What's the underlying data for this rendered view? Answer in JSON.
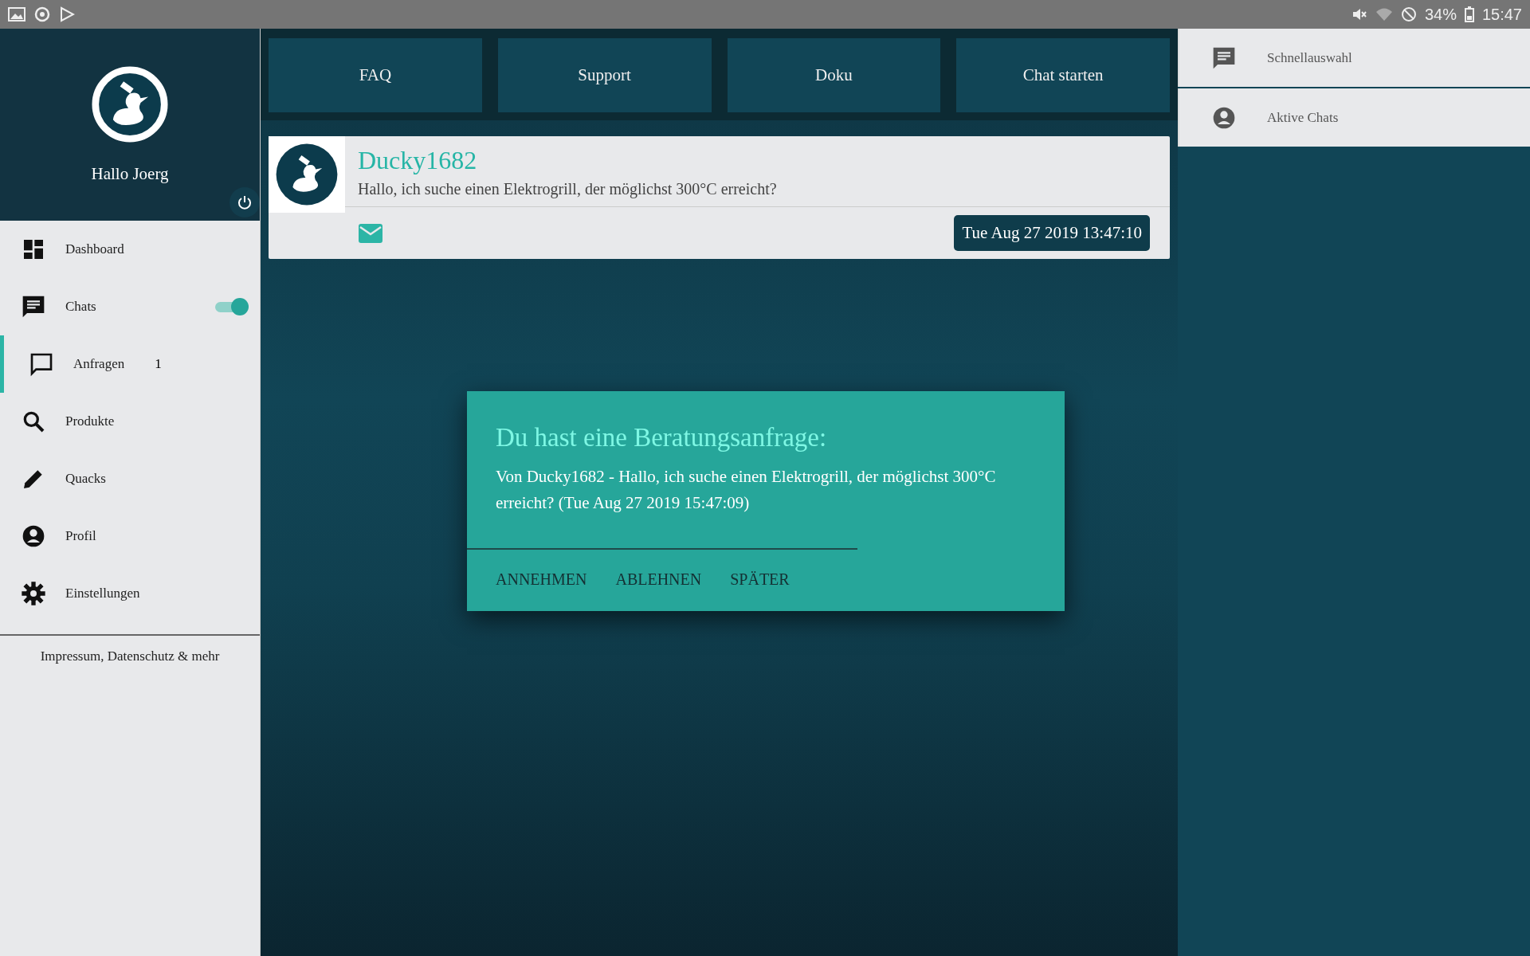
{
  "status_bar": {
    "battery": "34%",
    "time": "15:47"
  },
  "sidebar": {
    "greeting": "Hallo Joerg",
    "items": [
      {
        "label": "Dashboard",
        "kind": "link",
        "selected": false
      },
      {
        "label": "Chats",
        "kind": "toggle",
        "selected": false,
        "on": true
      },
      {
        "label": "Anfragen",
        "kind": "badge",
        "selected": true,
        "badge": "1"
      },
      {
        "label": "Produkte",
        "kind": "link",
        "selected": false
      },
      {
        "label": "Quacks",
        "kind": "link",
        "selected": false
      },
      {
        "label": "Profil",
        "kind": "link",
        "selected": false
      },
      {
        "label": "Einstellungen",
        "kind": "link",
        "selected": false
      }
    ],
    "footer": "Impressum, Datenschutz & mehr"
  },
  "top_buttons": [
    "FAQ",
    "Support",
    "Doku",
    "Chat starten"
  ],
  "message": {
    "sender": "Ducky1682",
    "text": "Hallo, ich suche einen Elektrogrill, der möglichst 300°C erreicht?",
    "timestamp": "Tue Aug 27 2019 13:47:10"
  },
  "right_panel": {
    "items": [
      "Schnellauswahl",
      "Aktive Chats"
    ]
  },
  "dialog": {
    "title": "Du hast eine Beratungsanfrage:",
    "body": "Von Ducky1682 - Hallo, ich suche einen Elektrogrill, der möglichst 300°C erreicht? (Tue Aug 27 2019 15:47:09)",
    "actions": [
      "ANNEHMEN",
      "ABLEHNEN",
      "SPÄTER"
    ]
  }
}
